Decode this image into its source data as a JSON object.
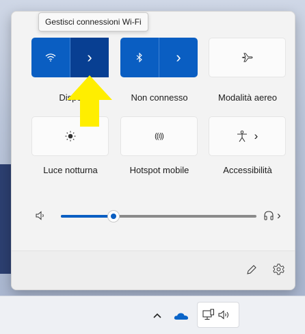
{
  "tooltip": "Gestisci connessioni Wi-Fi",
  "tiles": {
    "wifi": {
      "label": "Dispo",
      "icon": "wifi-icon",
      "arrow": "›"
    },
    "bluetooth": {
      "label": "Non connesso",
      "icon": "bluetooth-icon",
      "arrow": "›"
    },
    "airplane": {
      "label": "Modalità aereo",
      "icon": "airplane-icon"
    },
    "night_light": {
      "label": "Luce notturna",
      "icon": "brightness-icon"
    },
    "hotspot": {
      "label": "Hotspot mobile",
      "icon": "hotspot-icon",
      "glyph": "((ı))"
    },
    "accessibility": {
      "label": "Accessibilità",
      "icon": "accessibility-icon",
      "arrow": "›"
    }
  },
  "volume": {
    "level_fraction": 0.27,
    "speaker_icon": "speaker-icon",
    "output_icon": "headphones-icon",
    "arrow": "›"
  },
  "footer": {
    "edit_icon": "pencil-icon",
    "settings_icon": "gear-icon"
  },
  "taskbar": {
    "overflow_icon": "chevron-up-icon",
    "cloud_icon": "onedrive-icon",
    "network_icon": "network-icon",
    "volume_icon": "volume-icon"
  },
  "colors": {
    "accent": "#0a5ec2",
    "accent_pressed": "#083f92",
    "highlight_arrow": "#ffee00"
  }
}
